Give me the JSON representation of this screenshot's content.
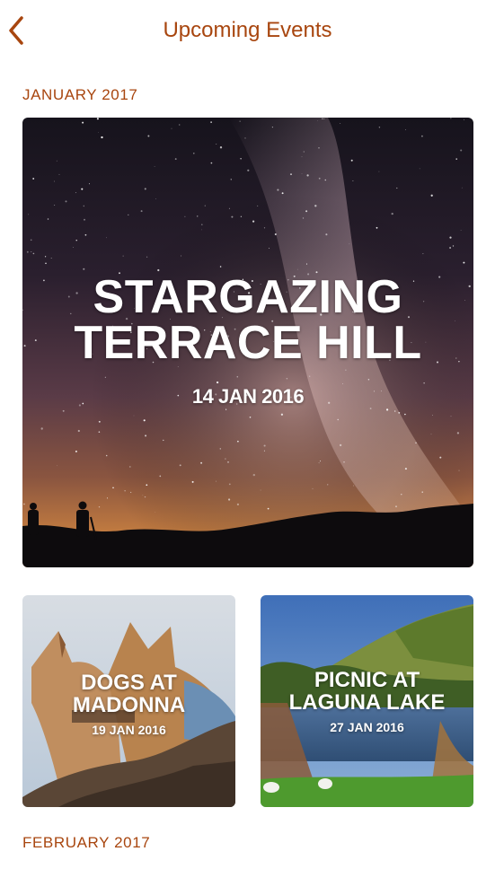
{
  "header": {
    "title": "Upcoming Events",
    "back_icon": "chevron-left-icon",
    "accent_color": "#a8460f"
  },
  "sections": [
    {
      "label": "JANUARY 2017",
      "featured": {
        "title_line1": "STARGAZING",
        "title_line2": "TERRACE HILL",
        "date": "14 JAN 2016"
      },
      "events": [
        {
          "title_line1": "DOGS AT",
          "title_line2": "MADONNA",
          "date": "19 JAN 2016"
        },
        {
          "title_line1": "PICNIC AT",
          "title_line2": "LAGUNA LAKE",
          "date": "27 JAN 2016"
        }
      ]
    },
    {
      "label": "FEBRUARY 2017"
    }
  ]
}
